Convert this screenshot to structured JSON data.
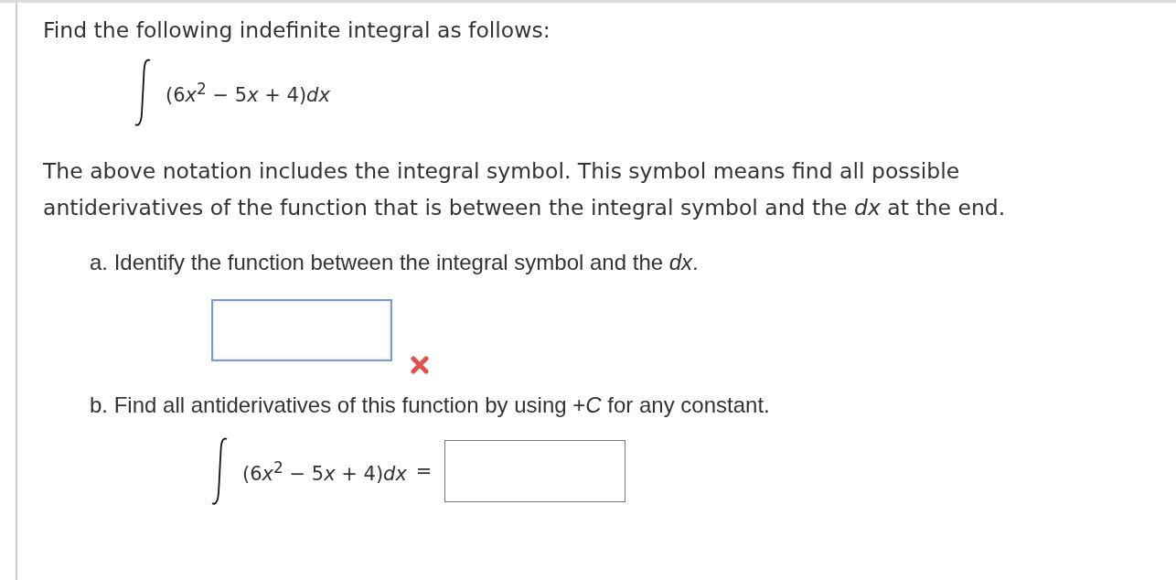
{
  "question": {
    "title": "Find the following indefinite integral as follows:",
    "integral": {
      "expression": [
        {
          "kind": "plain",
          "text": "(6"
        },
        {
          "kind": "var",
          "text": "x"
        },
        {
          "kind": "sup",
          "text": "2"
        },
        {
          "kind": "plain",
          "text": " − 5"
        },
        {
          "kind": "var",
          "text": "x"
        },
        {
          "kind": "plain",
          "text": " + 4)"
        },
        {
          "kind": "var",
          "text": "dx"
        }
      ]
    },
    "explanation": "The above notation includes the integral symbol. This symbol means find all possible antiderivatives of the function that is between the integral symbol and the *dx* at the end."
  },
  "parts": [
    {
      "label": "a. Identify the function between the integral symbol and the *dx*.",
      "kind": "answer",
      "incorrect": true
    },
    {
      "label": "b. Find all antiderivatives of this function by using +*C* for any constant.",
      "kind": "integral",
      "expression": [
        {
          "kind": "plain",
          "text": "(6"
        },
        {
          "kind": "var",
          "text": "x"
        },
        {
          "kind": "sup",
          "text": "2"
        },
        {
          "kind": "plain",
          "text": " − 5"
        },
        {
          "kind": "var",
          "text": "x"
        },
        {
          "kind": "plain",
          "text": " + 4)"
        },
        {
          "kind": "var",
          "text": "dx"
        }
      ],
      "equals": "="
    }
  ]
}
